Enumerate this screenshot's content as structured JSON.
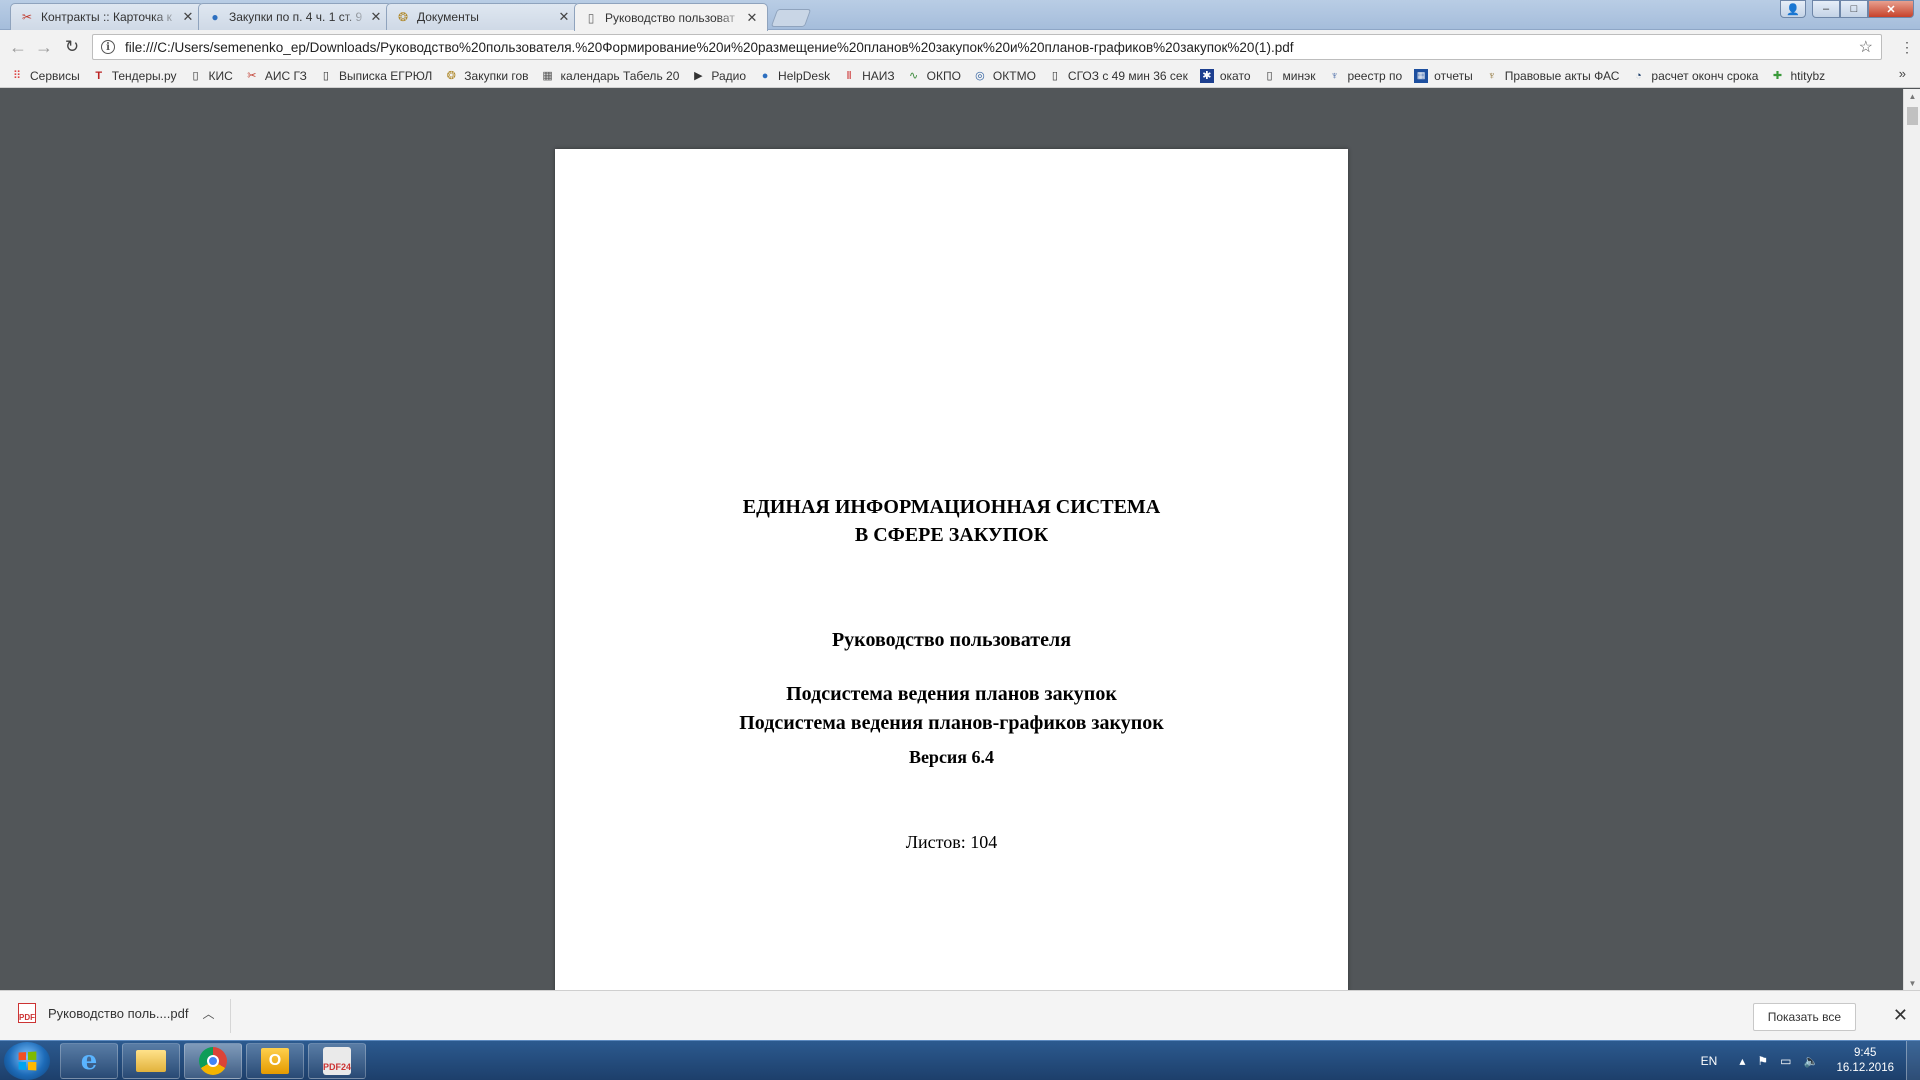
{
  "tabs": [
    {
      "label": "Контракты :: Карточка к",
      "icon": "tool-icon",
      "close": "✕"
    },
    {
      "label": "Закупки по п. 4 ч. 1 ст. 9",
      "icon": "globe-icon",
      "close": "✕"
    },
    {
      "label": "Документы",
      "icon": "emblem-icon",
      "close": "✕"
    },
    {
      "label": "Руководство пользоват",
      "icon": "page-icon",
      "close": "✕",
      "active": true
    }
  ],
  "window_controls": {
    "minimize": "–",
    "maximize": "□",
    "close": "✕"
  },
  "address_bar": {
    "url": "file:///C:/Users/semenenko_ep/Downloads/Руководство%20пользователя.%20Формирование%20и%20размещение%20планов%20закупок%20и%20планов-графиков%20закупок%20(1).pdf"
  },
  "bookmarks": [
    {
      "label": "Сервисы",
      "icon": "apps-icon"
    },
    {
      "label": "Тендеры.ру",
      "icon": "t-icon"
    },
    {
      "label": "КИС",
      "icon": "page-icon"
    },
    {
      "label": "АИС ГЗ",
      "icon": "tool-icon"
    },
    {
      "label": "Выписка ЕГРЮЛ",
      "icon": "page-icon"
    },
    {
      "label": "Закупки гов",
      "icon": "emblem-icon"
    },
    {
      "label": "календарь Табель 20",
      "icon": "calendar-icon"
    },
    {
      "label": "Радио",
      "icon": "play-icon"
    },
    {
      "label": "HelpDesk",
      "icon": "globe-icon"
    },
    {
      "label": "НАИЗ",
      "icon": "naiz-icon"
    },
    {
      "label": "ОКПО",
      "icon": "link-icon"
    },
    {
      "label": "ОКТМО",
      "icon": "circle-icon"
    },
    {
      "label": "СГОЗ с 49 мин 36 сек",
      "icon": "page-icon"
    },
    {
      "label": "окато",
      "icon": "star-box-icon"
    },
    {
      "label": "минэк",
      "icon": "page-icon"
    },
    {
      "label": "реестр по",
      "icon": "eagle-icon"
    },
    {
      "label": "отчеты",
      "icon": "grid-icon"
    },
    {
      "label": "Правовые акты ФАС",
      "icon": "eagle-icon"
    },
    {
      "label": "расчет оконч срока",
      "icon": "clock-icon"
    },
    {
      "label": "htitybz",
      "icon": "puzzle-icon"
    }
  ],
  "bookmarks_more": "»",
  "document": {
    "heading_line1": "ЕДИНАЯ ИНФОРМАЦИОННАЯ СИСТЕМА",
    "heading_line2": "В СФЕРЕ ЗАКУПОК",
    "subtitle": "Руководство пользователя",
    "subsystem1": "Подсистема ведения планов закупок",
    "subsystem2": "Подсистема ведения планов-графиков закупок",
    "version": "Версия 6.4",
    "sheets": "Листов: 104"
  },
  "download_shelf": {
    "file": "Руководство поль....pdf",
    "show_all": "Показать все"
  },
  "taskbar": {
    "lang": "EN",
    "time": "9:45",
    "date": "16.12.2016"
  }
}
